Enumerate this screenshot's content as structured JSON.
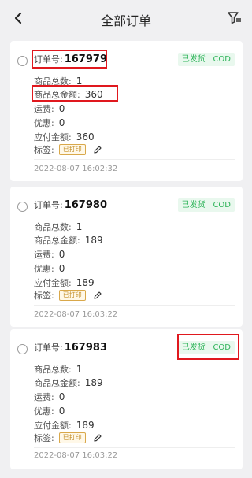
{
  "header": {
    "title": "全部订单"
  },
  "labels": {
    "order_no": "订单号:",
    "item_count": "商品总数:",
    "item_amount": "商品总金额:",
    "shipping": "运费:",
    "discount": "优惠:",
    "payable": "应付金额:",
    "tags": "标签:"
  },
  "orders": [
    {
      "order_no": "167979",
      "status": "已发货 | COD",
      "item_count": "1",
      "item_amount": "360",
      "shipping": "0",
      "discount": "0",
      "payable": "360",
      "tag": "已打印",
      "time": "2022-08-07 16:02:32"
    },
    {
      "order_no": "167980",
      "status": "已发货 | COD",
      "item_count": "1",
      "item_amount": "189",
      "shipping": "0",
      "discount": "0",
      "payable": "189",
      "tag": "已打印",
      "time": "2022-08-07 16:03:22"
    },
    {
      "order_no": "167983",
      "status": "已发货 | COD",
      "item_count": "1",
      "item_amount": "189",
      "shipping": "0",
      "discount": "0",
      "payable": "189",
      "tag": "已打印",
      "time": "2022-08-07 16:03:22"
    }
  ],
  "colors": {
    "status_text": "#2fb45a",
    "status_bg": "#e9f8ee",
    "tag_border": "#d9a84a",
    "highlight": "#e0181e"
  }
}
